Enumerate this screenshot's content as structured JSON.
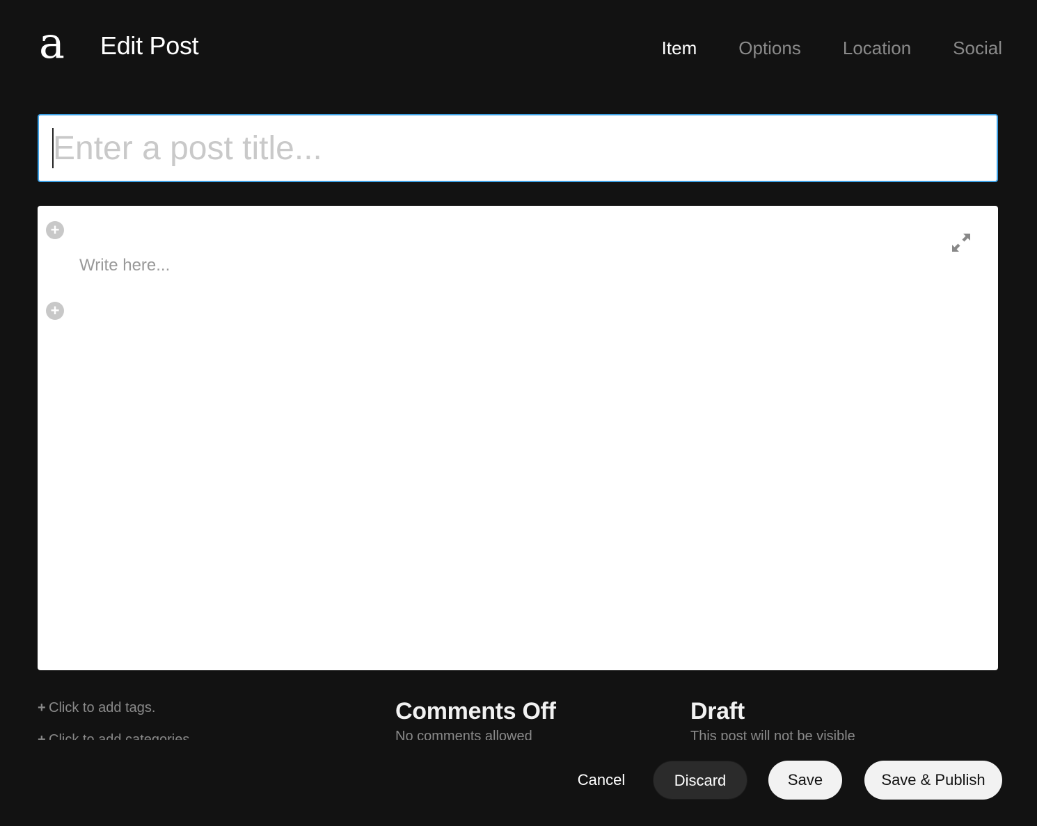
{
  "header": {
    "logo_text": "a",
    "title": "Edit Post",
    "tabs": [
      {
        "label": "Item",
        "active": true
      },
      {
        "label": "Options",
        "active": false
      },
      {
        "label": "Location",
        "active": false
      },
      {
        "label": "Social",
        "active": false
      }
    ]
  },
  "title_input": {
    "value": "",
    "placeholder": "Enter a post title..."
  },
  "editor": {
    "placeholder": "Write here...",
    "add_block_icon": "plus-circle-icon",
    "expand_icon": "expand-icon"
  },
  "meta": {
    "tags_label": "Click to add tags.",
    "categories_label": "Click to add categories",
    "comments_title": "Comments Off",
    "comments_sub": "No comments allowed",
    "status_title": "Draft",
    "status_sub": "This post will not be visible"
  },
  "actions": {
    "cancel_label": "Cancel",
    "discard_label": "Discard",
    "save_label": "Save",
    "publish_label": "Save & Publish"
  },
  "colors": {
    "background": "#121212",
    "accent_focus": "#3da1e6",
    "muted_text": "#8a8a8a"
  }
}
